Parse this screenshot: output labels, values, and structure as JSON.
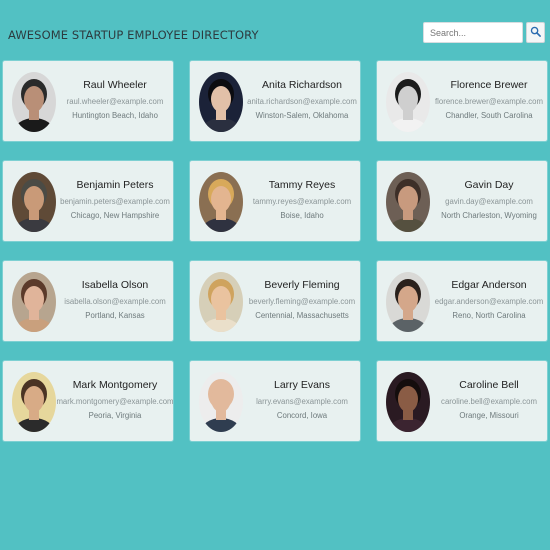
{
  "header": {
    "title": "AWESOME STARTUP EMPLOYEE DIRECTORY",
    "search_placeholder": "Search...",
    "search_icon": "search-icon"
  },
  "employees": [
    {
      "name": "Raul Wheeler",
      "email": "raul.wheeler@example.com",
      "location": "Huntington Beach, Idaho",
      "photo": {
        "bg": "#d7d7d7",
        "skin": "#b98f77",
        "hair": "#2a2a2a",
        "shirt": "#1a1a1a"
      }
    },
    {
      "name": "Anita Richardson",
      "email": "anita.richardson@example.com",
      "location": "Winston-Salem, Oklahoma",
      "photo": {
        "bg": "#1b2238",
        "skin": "#e2c0a8",
        "hair": "#0c0c10",
        "shirt": "#2a2f3f"
      }
    },
    {
      "name": "Florence Brewer",
      "email": "florence.brewer@example.com",
      "location": "Chandler, South Carolina",
      "photo": {
        "bg": "#e9e9e9",
        "skin": "#cfcfcf",
        "hair": "#1b1b1b",
        "shirt": "#f2f2f2"
      }
    },
    {
      "name": "Benjamin Peters",
      "email": "benjamin.peters@example.com",
      "location": "Chicago, New Hampshire",
      "photo": {
        "bg": "#5f4a37",
        "skin": "#c99a78",
        "hair": "#4b4b45",
        "shirt": "#3a3a40"
      }
    },
    {
      "name": "Tammy Reyes",
      "email": "tammy.reyes@example.com",
      "location": "Boise, Idaho",
      "photo": {
        "bg": "#8a6f52",
        "skin": "#e3b590",
        "hair": "#d8a95a",
        "shirt": "#2f3240"
      }
    },
    {
      "name": "Gavin Day",
      "email": "gavin.day@example.com",
      "location": "North Charleston, Wyoming",
      "photo": {
        "bg": "#6d5f55",
        "skin": "#c89a7e",
        "hair": "#3d2f28",
        "shirt": "#55503f"
      }
    },
    {
      "name": "Isabella Olson",
      "email": "isabella.olson@example.com",
      "location": "Portland, Kansas",
      "photo": {
        "bg": "#b7a58f",
        "skin": "#e0b49a",
        "hair": "#5b3a2a",
        "shirt": "#c9a07d"
      }
    },
    {
      "name": "Beverly Fleming",
      "email": "beverly.fleming@example.com",
      "location": "Centennial, Massachusetts",
      "photo": {
        "bg": "#d6cfb8",
        "skin": "#eac39f",
        "hair": "#cfa35e",
        "shirt": "#eadfca"
      }
    },
    {
      "name": "Edgar Anderson",
      "email": "edgar.anderson@example.com",
      "location": "Reno, North Carolina",
      "photo": {
        "bg": "#d9d9d6",
        "skin": "#d4a78a",
        "hair": "#2a211c",
        "shirt": "#5b6266"
      }
    },
    {
      "name": "Mark Montgomery",
      "email": "mark.montgomery@example.com",
      "location": "Peoria, Virginia",
      "photo": {
        "bg": "#e6d79c",
        "skin": "#d8ab86",
        "hair": "#4a3324",
        "shirt": "#2b2b2b"
      }
    },
    {
      "name": "Larry Evans",
      "email": "larry.evans@example.com",
      "location": "Concord, Iowa",
      "photo": {
        "bg": "#ededed",
        "skin": "#e2b99c",
        "hair": "#e2b99c",
        "shirt": "#2f3d50"
      }
    },
    {
      "name": "Caroline Bell",
      "email": "caroline.bell@example.com",
      "location": "Orange, Missouri",
      "photo": {
        "bg": "#2a1a22",
        "skin": "#8a5c45",
        "hair": "#140d0d",
        "shirt": "#3b2430"
      }
    }
  ]
}
